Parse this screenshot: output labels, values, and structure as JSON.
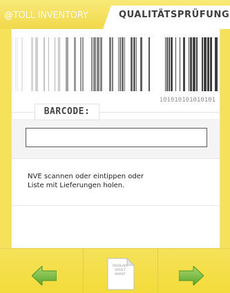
{
  "header": {
    "brand_at": "@",
    "brand_text": "TOLL INVENTORY",
    "active_tab_label": "QUALITÄTSPRÜFUNG"
  },
  "barcode_decor": {
    "digits": "101010101010101"
  },
  "barcode_field": {
    "label": "BARCODE:",
    "value": "",
    "placeholder": ""
  },
  "hint": {
    "line1": "NVE scannen oder eintippen oder",
    "line2": "Liste mit Lieferungen holen."
  },
  "toolbar": {
    "back_icon": "arrow-left-icon",
    "document_icon": "document-icon",
    "document_text": [
      "PRÜBUNY",
      "EPFALT",
      "MARKT"
    ],
    "next_icon": "arrow-right-icon"
  },
  "colors": {
    "brand_yellow": "#f6e25a",
    "arrow_green": "#7dc142",
    "tab_text": "#3e3e3e"
  }
}
